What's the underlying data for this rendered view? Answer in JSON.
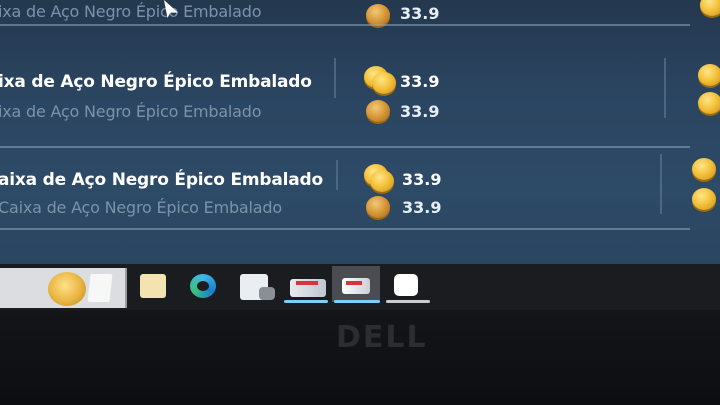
{
  "listings": [
    {
      "name": "Caixa de Aço Negro Épico Embalado",
      "name_visible": "",
      "subname_visible": "ixa de Aço Negro Épico Embalado",
      "price_top": "",
      "price_bottom": "33.9"
    },
    {
      "name": "Caixa de Aço Negro Épico Embalado",
      "name_visible": "ixa de Aço Negro Épico Embalado",
      "subname_visible": "ixa de Aço Negro Épico Embalado",
      "price_top": "33.9",
      "price_bottom": "33.9"
    },
    {
      "name": "Caixa de Aço Negro Épico Embalado",
      "name_visible": "aixa de Aço Negro Épico Embalado",
      "subname_visible": "Caixa de Aço Negro Épico Embalado",
      "price_top": "33.9",
      "price_bottom": "33.9"
    }
  ],
  "taskbar": {
    "items": [
      {
        "name": "search-box"
      },
      {
        "name": "file-explorer"
      },
      {
        "name": "edge-browser"
      },
      {
        "name": "store-app"
      },
      {
        "name": "game-app-1"
      },
      {
        "name": "game-app-2"
      },
      {
        "name": "white-app"
      }
    ]
  },
  "bezel": {
    "brand": "DELL"
  },
  "colors": {
    "screen_bg": "#2b4561",
    "text_primary": "#ffffff",
    "text_secondary": "#7b92ab",
    "coin_gold": "#f4c23c",
    "taskbar_bg": "#1b1c20",
    "active_indicator": "#7ad0f6"
  }
}
